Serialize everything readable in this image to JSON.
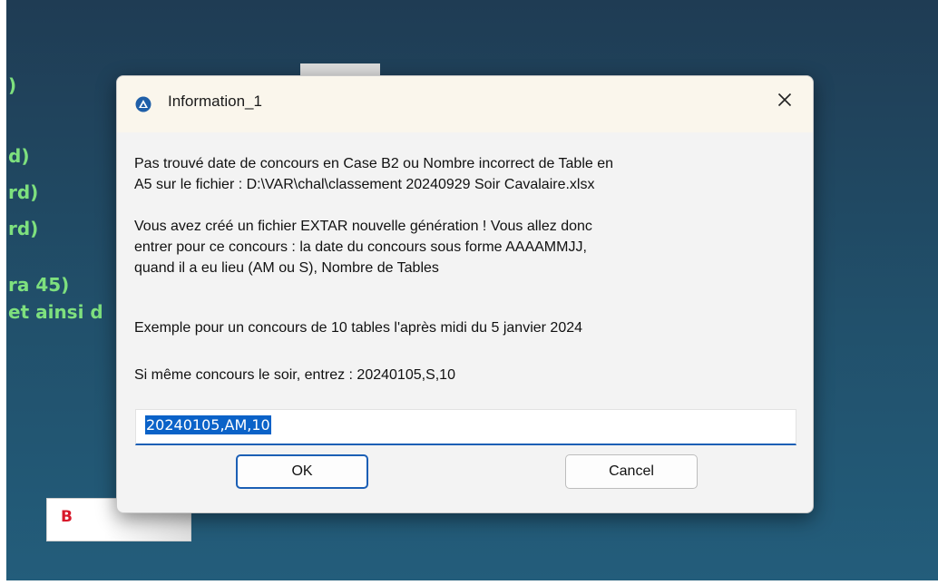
{
  "background": {
    "lines": [
      ")",
      "d)",
      "rd)",
      "rd)",
      "ra 45)",
      "et ainsi d"
    ],
    "button_b_label": "B"
  },
  "dialog": {
    "title": "Information_1",
    "app_icon": "app-logo-icon",
    "close_icon": "close-icon",
    "message_1_line_1": "Pas trouvé date de concours en Case B2 ou Nombre incorrect de Table en",
    "message_1_line_2": "A5 sur le fichier : D:\\VAR\\chal\\classement 20240929 Soir Cavalaire.xlsx",
    "message_2_line_1": "Vous avez créé un fichier EXTAR nouvelle génération ! Vous allez donc",
    "message_2_line_2": "entrer pour ce concours : la date du concours sous forme AAAAMMJJ,",
    "message_2_line_3": "quand il a eu lieu (AM ou S), Nombre de Tables",
    "message_3": "Exemple pour un concours de 10 tables l'après midi du 5 janvier 2024",
    "message_4": "Si même concours le soir, entrez : 20240105,S,10",
    "input_value": "20240105,AM,10",
    "ok_label": "OK",
    "cancel_label": "Cancel"
  },
  "colors": {
    "accent": "#1b5fb5",
    "selection": "#0a62c8",
    "background_text": "#7ee07e",
    "b_label": "#d8182a"
  }
}
